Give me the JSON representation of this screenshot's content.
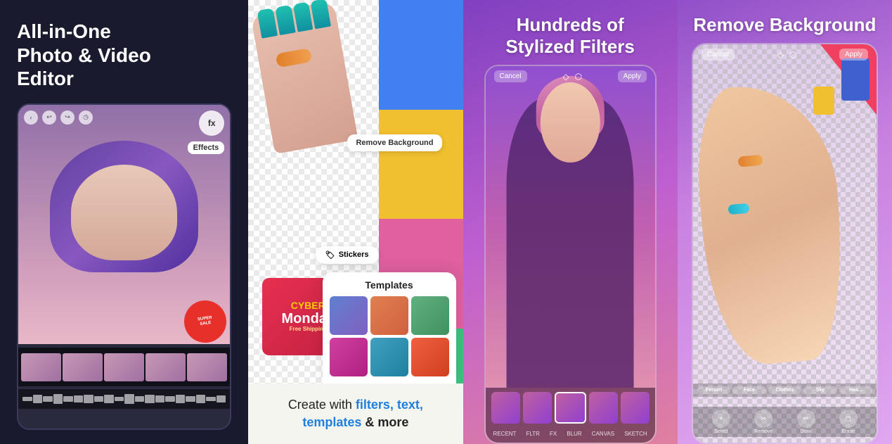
{
  "panels": {
    "panel1": {
      "title": "All-in-One\nPhoto & Video\nEditor",
      "effects_label": "Effects",
      "promo": {
        "line1": "SUPER",
        "line2": "SALE"
      }
    },
    "panel2": {
      "bg_remove_tooltip": "Remove Background",
      "templates_title": "Templates",
      "stickers_label": "Stickers",
      "cyber_monday": {
        "cyber": "CYBER",
        "monday": "Monday",
        "shipping": "Free Shipping"
      },
      "bottom_text": "Create with filters, text, templates & more",
      "bottom_text_highlights": [
        "filters,",
        "text, templates",
        "& more"
      ]
    },
    "panel3": {
      "title": "Hundreds of\nStylized Filters",
      "cancel_label": "Cancel",
      "apply_label": "Apply",
      "filter_labels": [
        "RECENT",
        "FLTR",
        "FX",
        "BLUR",
        "CANVAS",
        "SKETCH"
      ]
    },
    "panel4": {
      "title": "Remove Background",
      "cancel_label": "Cancel",
      "apply_label": "Apply",
      "category_tabs": [
        "Person",
        "Face",
        "Clothes",
        "Sky",
        "Hea..."
      ],
      "tool_labels": [
        "Select",
        "Remove",
        "Draw",
        "Erase"
      ]
    }
  }
}
